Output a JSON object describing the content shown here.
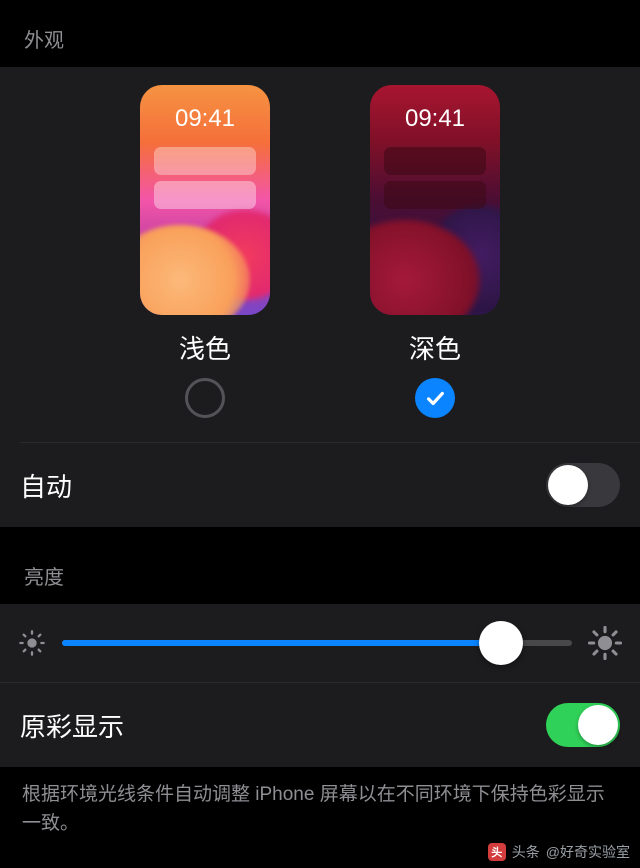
{
  "appearance": {
    "header": "外观",
    "options": {
      "light": {
        "label": "浅色",
        "time": "09:41",
        "selected": false
      },
      "dark": {
        "label": "深色",
        "time": "09:41",
        "selected": true
      }
    },
    "auto_row": {
      "label": "自动",
      "enabled": false
    }
  },
  "brightness": {
    "header": "亮度",
    "slider_percent": 86,
    "true_tone": {
      "label": "原彩显示",
      "enabled": true
    },
    "description": "根据环境光线条件自动调整 iPhone 屏幕以在不同环境下保持色彩显示一致。"
  },
  "watermark": {
    "prefix": "头条",
    "handle": "@好奇实验室"
  }
}
